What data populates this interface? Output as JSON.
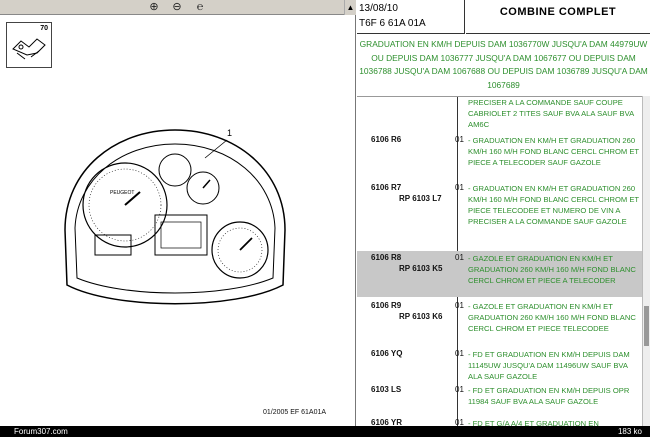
{
  "toolbar": {
    "icons": [
      "zoom-in-icon",
      "zoom-out-icon",
      "zoom-reset-icon"
    ],
    "icon_glyphs": [
      "⊕",
      "⊖",
      "℮"
    ]
  },
  "thumbnail": {
    "number": "70"
  },
  "drawing": {
    "callout": "1",
    "gauge_label": "PEUGEOT"
  },
  "footer_ref": "01/2005   EF 61A01A",
  "header": {
    "date": "13/08/10",
    "code": "T6F 6 61A 01A",
    "title": "COMBINE COMPLET"
  },
  "banner": "GRADUATION EN KM/H DEPUIS DAM 1036770W JUSQU'A DAM 44979UW OU DEPUIS DAM 1036777 JUSQU'A DAM 1067677 OU DEPUIS DAM 1036788 JUSQU'A DAM 1067688 OU DEPUIS DAM 1036789 JUSQU'A DAM 1067689",
  "entries": [
    {
      "ref": "",
      "ref2": "",
      "qty": "",
      "desc": "PRECISER A LA COMMANDE SAUF COUPE CABRIOLET 2 TITES SAUF BVA ALA SAUF BVA AM6C"
    },
    {
      "ref": "6106 R6",
      "ref2": "",
      "qty": "01",
      "desc": "- GRADUATION EN KM/H ET GRADUATION 260 KM/H 160 M/H FOND BLANC CERCL CHROM ET PIECE A TELECODER SAUF GAZOLE"
    },
    {
      "ref": "6106 R7",
      "ref2": "RP 6103 L7",
      "qty": "01",
      "desc": "- GRADUATION EN KM/H ET GRADUATION 260 KM/H 160 M/H FOND BLANC CERCL CHROM ET PIECE TELECODEE ET NUMERO DE VIN A PRECISER A LA COMMANDE SAUF GAZOLE"
    },
    {
      "ref": "6106 R8",
      "ref2": "RP 6103 K5",
      "qty": "01",
      "desc": "- GAZOLE ET GRADUATION EN KM/H ET GRADUATION 260 KM/H 160 M/H FOND BLANC CERCL CHROM ET PIECE A TELECODER"
    },
    {
      "ref": "6106 R9",
      "ref2": "RP 6103 K6",
      "qty": "01",
      "desc": "- GAZOLE ET GRADUATION EN KM/H ET GRADUATION 260 KM/H 160 M/H FOND BLANC CERCL CHROM ET PIECE TELECODEE"
    },
    {
      "ref": "6106 YQ",
      "ref2": "",
      "qty": "01",
      "desc": "- FD ET GRADUATION EN KM/H DEPUIS DAM 11145UW JUSQU'A DAM 11496UW SAUF BVA ALA SAUF GAZOLE"
    },
    {
      "ref": "6103 LS",
      "ref2": "",
      "qty": "01",
      "desc": "- FD ET GRADUATION EN KM/H DEPUIS OPR 11984 SAUF BVA ALA SAUF GAZOLE"
    },
    {
      "ref": "6106 YR",
      "ref2": "",
      "qty": "01",
      "desc": "- FD ET G/A A/4 ET GRADUATION EN"
    }
  ],
  "status": {
    "left": "Forum307.com",
    "right": "183 ko"
  },
  "colors": {
    "green_text": "#2d8f2d",
    "selected_row": "#c8c8c8"
  }
}
